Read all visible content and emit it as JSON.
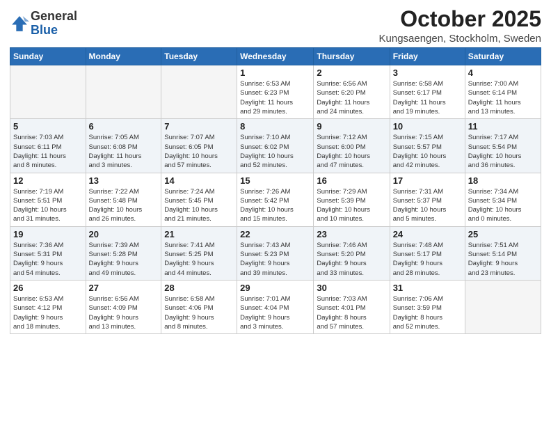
{
  "header": {
    "logo_general": "General",
    "logo_blue": "Blue",
    "month": "October 2025",
    "location": "Kungsaengen, Stockholm, Sweden"
  },
  "weekdays": [
    "Sunday",
    "Monday",
    "Tuesday",
    "Wednesday",
    "Thursday",
    "Friday",
    "Saturday"
  ],
  "weeks": [
    [
      {
        "day": "",
        "info": ""
      },
      {
        "day": "",
        "info": ""
      },
      {
        "day": "",
        "info": ""
      },
      {
        "day": "1",
        "info": "Sunrise: 6:53 AM\nSunset: 6:23 PM\nDaylight: 11 hours\nand 29 minutes."
      },
      {
        "day": "2",
        "info": "Sunrise: 6:56 AM\nSunset: 6:20 PM\nDaylight: 11 hours\nand 24 minutes."
      },
      {
        "day": "3",
        "info": "Sunrise: 6:58 AM\nSunset: 6:17 PM\nDaylight: 11 hours\nand 19 minutes."
      },
      {
        "day": "4",
        "info": "Sunrise: 7:00 AM\nSunset: 6:14 PM\nDaylight: 11 hours\nand 13 minutes."
      }
    ],
    [
      {
        "day": "5",
        "info": "Sunrise: 7:03 AM\nSunset: 6:11 PM\nDaylight: 11 hours\nand 8 minutes."
      },
      {
        "day": "6",
        "info": "Sunrise: 7:05 AM\nSunset: 6:08 PM\nDaylight: 11 hours\nand 3 minutes."
      },
      {
        "day": "7",
        "info": "Sunrise: 7:07 AM\nSunset: 6:05 PM\nDaylight: 10 hours\nand 57 minutes."
      },
      {
        "day": "8",
        "info": "Sunrise: 7:10 AM\nSunset: 6:02 PM\nDaylight: 10 hours\nand 52 minutes."
      },
      {
        "day": "9",
        "info": "Sunrise: 7:12 AM\nSunset: 6:00 PM\nDaylight: 10 hours\nand 47 minutes."
      },
      {
        "day": "10",
        "info": "Sunrise: 7:15 AM\nSunset: 5:57 PM\nDaylight: 10 hours\nand 42 minutes."
      },
      {
        "day": "11",
        "info": "Sunrise: 7:17 AM\nSunset: 5:54 PM\nDaylight: 10 hours\nand 36 minutes."
      }
    ],
    [
      {
        "day": "12",
        "info": "Sunrise: 7:19 AM\nSunset: 5:51 PM\nDaylight: 10 hours\nand 31 minutes."
      },
      {
        "day": "13",
        "info": "Sunrise: 7:22 AM\nSunset: 5:48 PM\nDaylight: 10 hours\nand 26 minutes."
      },
      {
        "day": "14",
        "info": "Sunrise: 7:24 AM\nSunset: 5:45 PM\nDaylight: 10 hours\nand 21 minutes."
      },
      {
        "day": "15",
        "info": "Sunrise: 7:26 AM\nSunset: 5:42 PM\nDaylight: 10 hours\nand 15 minutes."
      },
      {
        "day": "16",
        "info": "Sunrise: 7:29 AM\nSunset: 5:39 PM\nDaylight: 10 hours\nand 10 minutes."
      },
      {
        "day": "17",
        "info": "Sunrise: 7:31 AM\nSunset: 5:37 PM\nDaylight: 10 hours\nand 5 minutes."
      },
      {
        "day": "18",
        "info": "Sunrise: 7:34 AM\nSunset: 5:34 PM\nDaylight: 10 hours\nand 0 minutes."
      }
    ],
    [
      {
        "day": "19",
        "info": "Sunrise: 7:36 AM\nSunset: 5:31 PM\nDaylight: 9 hours\nand 54 minutes."
      },
      {
        "day": "20",
        "info": "Sunrise: 7:39 AM\nSunset: 5:28 PM\nDaylight: 9 hours\nand 49 minutes."
      },
      {
        "day": "21",
        "info": "Sunrise: 7:41 AM\nSunset: 5:25 PM\nDaylight: 9 hours\nand 44 minutes."
      },
      {
        "day": "22",
        "info": "Sunrise: 7:43 AM\nSunset: 5:23 PM\nDaylight: 9 hours\nand 39 minutes."
      },
      {
        "day": "23",
        "info": "Sunrise: 7:46 AM\nSunset: 5:20 PM\nDaylight: 9 hours\nand 33 minutes."
      },
      {
        "day": "24",
        "info": "Sunrise: 7:48 AM\nSunset: 5:17 PM\nDaylight: 9 hours\nand 28 minutes."
      },
      {
        "day": "25",
        "info": "Sunrise: 7:51 AM\nSunset: 5:14 PM\nDaylight: 9 hours\nand 23 minutes."
      }
    ],
    [
      {
        "day": "26",
        "info": "Sunrise: 6:53 AM\nSunset: 4:12 PM\nDaylight: 9 hours\nand 18 minutes."
      },
      {
        "day": "27",
        "info": "Sunrise: 6:56 AM\nSunset: 4:09 PM\nDaylight: 9 hours\nand 13 minutes."
      },
      {
        "day": "28",
        "info": "Sunrise: 6:58 AM\nSunset: 4:06 PM\nDaylight: 9 hours\nand 8 minutes."
      },
      {
        "day": "29",
        "info": "Sunrise: 7:01 AM\nSunset: 4:04 PM\nDaylight: 9 hours\nand 3 minutes."
      },
      {
        "day": "30",
        "info": "Sunrise: 7:03 AM\nSunset: 4:01 PM\nDaylight: 8 hours\nand 57 minutes."
      },
      {
        "day": "31",
        "info": "Sunrise: 7:06 AM\nSunset: 3:59 PM\nDaylight: 8 hours\nand 52 minutes."
      },
      {
        "day": "",
        "info": ""
      }
    ]
  ]
}
